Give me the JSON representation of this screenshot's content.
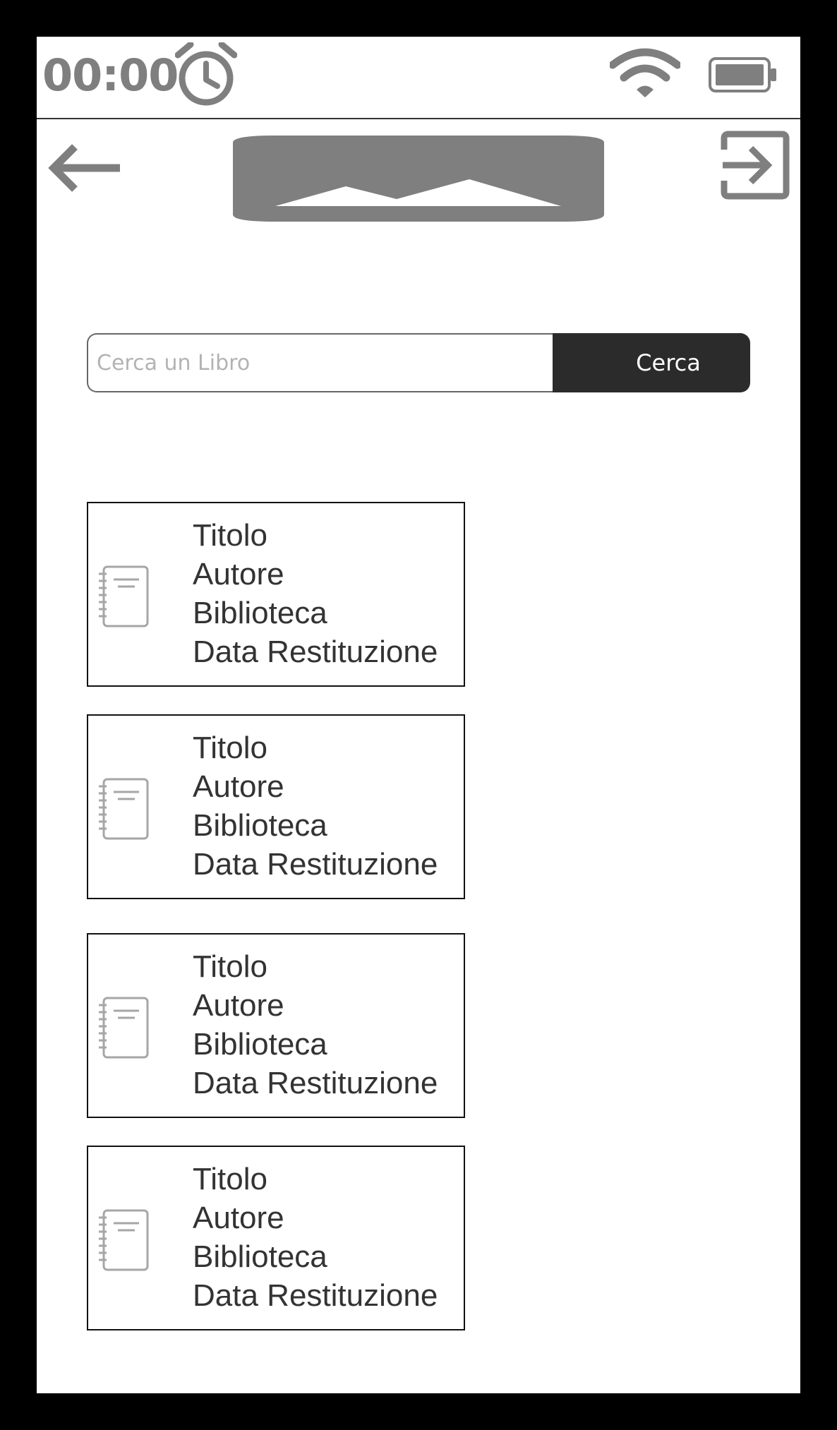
{
  "status_bar": {
    "time": "00:00",
    "icons": [
      "alarm-clock-icon",
      "wifi-icon",
      "battery-icon"
    ]
  },
  "header": {
    "back_icon": "arrow-left-icon",
    "logo_icon": "image-placeholder-icon",
    "exit_icon": "logout-icon"
  },
  "search": {
    "placeholder": "Cerca un Libro",
    "value": "",
    "button_label": "Cerca"
  },
  "books": [
    {
      "icon": "notebook-icon",
      "title": "Titolo",
      "author": "Autore",
      "library": "Biblioteca",
      "return_date": "Data Restituzione"
    },
    {
      "icon": "notebook-icon",
      "title": "Titolo",
      "author": "Autore",
      "library": "Biblioteca",
      "return_date": "Data Restituzione"
    },
    {
      "icon": "notebook-icon",
      "title": "Titolo",
      "author": "Autore",
      "library": "Biblioteca",
      "return_date": "Data Restituzione"
    },
    {
      "icon": "notebook-icon",
      "title": "Titolo",
      "author": "Autore",
      "library": "Biblioteca",
      "return_date": "Data Restituzione"
    }
  ],
  "colors": {
    "frame": "#000000",
    "screen": "#ffffff",
    "icon_gray": "#7f7f7f",
    "button_dark": "#2b2b2b",
    "text": "#333333"
  }
}
